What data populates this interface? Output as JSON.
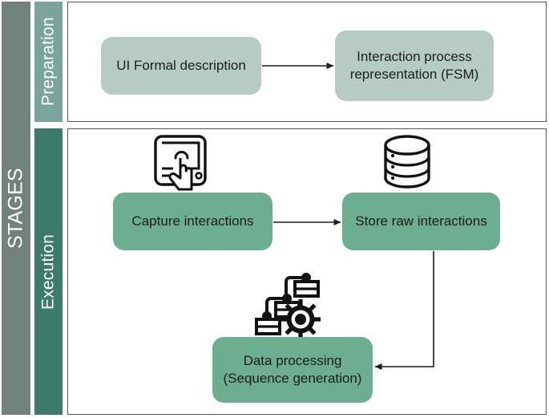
{
  "axis": {
    "stages_label": "STAGES"
  },
  "stages": [
    {
      "id": "preparation",
      "label": "Preparation",
      "bar_color": "#79a59c",
      "box_color": "#b6cbc4"
    },
    {
      "id": "execution",
      "label": "Execution",
      "bar_color": "#3d7a6a",
      "box_color": "#6dae90"
    }
  ],
  "preparation": {
    "boxes": [
      {
        "id": "ui-formal-description",
        "label": "UI Formal description"
      },
      {
        "id": "interaction-process-representation",
        "label": "Interaction process representation (FSM)"
      }
    ],
    "arrows": [
      {
        "from": "ui-formal-description",
        "to": "interaction-process-representation",
        "direction": "right"
      }
    ]
  },
  "execution": {
    "boxes": [
      {
        "id": "capture-interactions",
        "label": "Capture interactions",
        "icon": "tablet-touch-icon"
      },
      {
        "id": "store-raw-interactions",
        "label": "Store raw interactions",
        "icon": "database-icon"
      },
      {
        "id": "data-processing",
        "label": "Data processing (Sequence generation)",
        "icon": "data-flow-gear-icon"
      }
    ],
    "arrows": [
      {
        "from": "capture-interactions",
        "to": "store-raw-interactions",
        "direction": "right"
      },
      {
        "from": "store-raw-interactions",
        "to": "data-processing",
        "direction": "elbow-down-left"
      }
    ]
  },
  "colors": {
    "stages_bar": "#71817b",
    "panel_border": "#555555",
    "connector": "#1c1c1c",
    "background": "#ffffff",
    "text_dark": "#1c1c1c",
    "text_light": "#ffffff"
  }
}
